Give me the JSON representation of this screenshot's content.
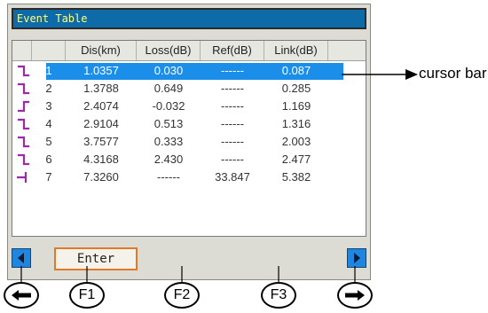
{
  "window": {
    "title": "Event Table"
  },
  "table": {
    "columns": [
      "",
      "",
      "Dis(km)",
      "Loss(dB)",
      "Ref(dB)",
      "Link(dB)"
    ],
    "rows": [
      {
        "icon": "step-down-icon",
        "index": "1",
        "dis": "1.0357",
        "loss": "0.030",
        "ref": "------",
        "link": "0.087",
        "selected": true
      },
      {
        "icon": "step-down-icon",
        "index": "2",
        "dis": "1.3788",
        "loss": "0.649",
        "ref": "------",
        "link": "0.285"
      },
      {
        "icon": "step-up-icon",
        "index": "3",
        "dis": "2.4074",
        "loss": "-0.032",
        "ref": "------",
        "link": "1.169"
      },
      {
        "icon": "step-down-icon",
        "index": "4",
        "dis": "2.9104",
        "loss": "0.513",
        "ref": "------",
        "link": "1.316"
      },
      {
        "icon": "step-down-icon",
        "index": "5",
        "dis": "3.7577",
        "loss": "0.333",
        "ref": "------",
        "link": "2.003"
      },
      {
        "icon": "step-down-icon",
        "index": "6",
        "dis": "4.3168",
        "loss": "2.430",
        "ref": "------",
        "link": "2.477"
      },
      {
        "icon": "end-event-icon",
        "index": "7",
        "dis": "7.3260",
        "loss": "------",
        "ref": "33.847",
        "link": "5.382"
      }
    ]
  },
  "toolbar": {
    "enter_label": "Enter"
  },
  "callout": {
    "text": "cursor bar"
  },
  "hardkeys": {
    "f1": "F1",
    "f2": "F2",
    "f3": "F3"
  },
  "colors": {
    "accent": "#1a8ee8",
    "event_icon": "#9b2aa6",
    "title_text": "#ffff7a"
  }
}
